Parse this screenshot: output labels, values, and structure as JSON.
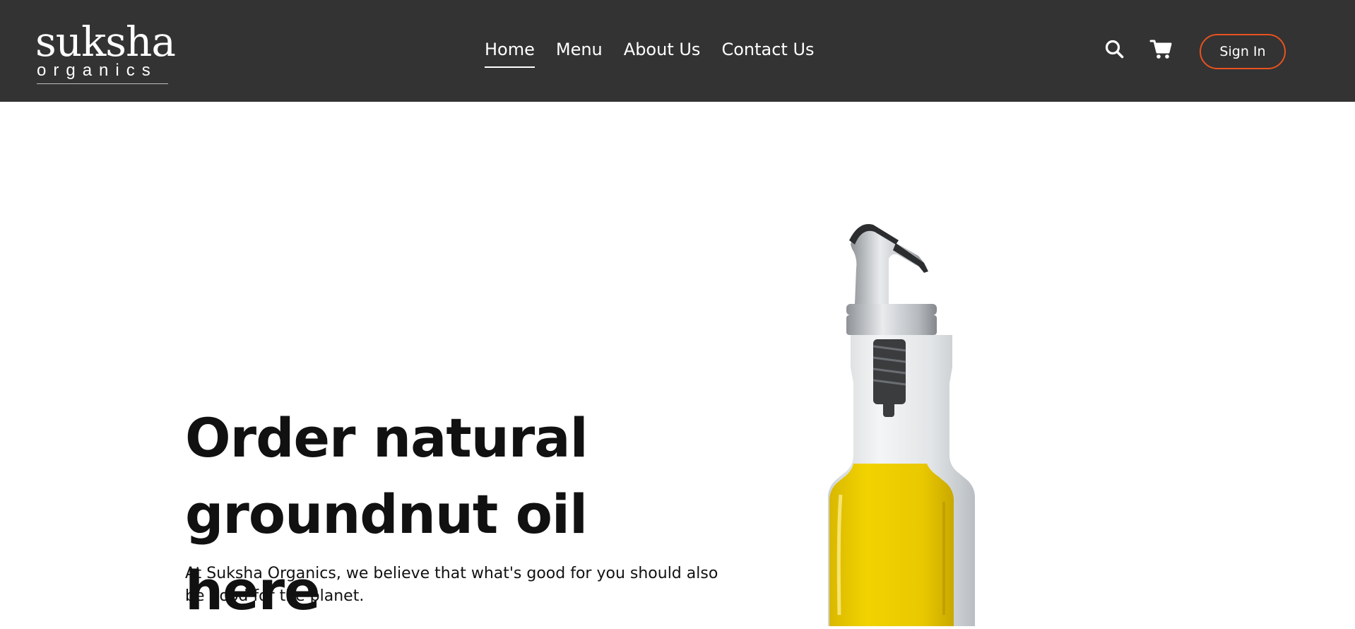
{
  "brand": {
    "name": "suksha",
    "tagline": "organics"
  },
  "nav": {
    "links": [
      {
        "label": "Home",
        "active": true
      },
      {
        "label": "Menu",
        "active": false
      },
      {
        "label": "About Us",
        "active": false
      },
      {
        "label": "Contact Us",
        "active": false
      }
    ]
  },
  "header_actions": {
    "search_icon": "search-icon",
    "cart_icon": "cart-icon",
    "signin_label": "Sign In"
  },
  "hero": {
    "heading_line1": "Order natural",
    "heading_line2": "groundnut oil here",
    "text": "At Suksha Organics, we believe that what's good for you should also be good for the planet.",
    "image": "oil-bottle-image"
  },
  "colors": {
    "navbar_bg": "#333333",
    "accent": "#e8521e",
    "oil": "#e8c800",
    "text": "#111111"
  }
}
